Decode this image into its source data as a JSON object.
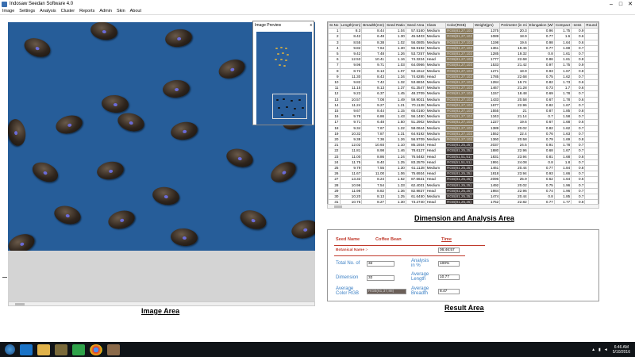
{
  "window": {
    "title": "Indosaw Seedan Software 4.0",
    "controls": [
      "–",
      "□",
      "✕"
    ]
  },
  "menu": [
    "Image",
    "Settings",
    "Analysis",
    "Cluster",
    "Reports",
    "Admin",
    "Skin",
    "About"
  ],
  "preview": {
    "title": "Image Preview",
    "close": "x"
  },
  "captions": {
    "image_area": "Image Area",
    "dimension_area": "Dimension and Analysis Area",
    "result_area": "Result  Area"
  },
  "table": {
    "headers": [
      "Sr.No",
      "Length(mm)",
      "Breadth(mm)",
      "Seed Ratio",
      "Seed Area",
      "Class",
      "Color(RGB)",
      "Weight(gm)",
      "Perimeter (in mi",
      "Elongation (W/",
      "Compact",
      "-ness",
      "Round"
    ],
    "rows": [
      [
        "1",
        "8.3",
        "8.44",
        "1.04",
        "57.5160",
        "Medium",
        "RGB(81,27,101",
        "1375",
        "20.3",
        "0.96",
        "1.75",
        "0.9"
      ],
      [
        "2",
        "8.42",
        "6.48",
        "1.30",
        "45.5403",
        "Medium",
        "RGB(81,27,102",
        "1089",
        "18.9",
        "0.77",
        "1.6",
        "0.6"
      ],
      [
        "3",
        "8.55",
        "8.38",
        "1.02",
        "56.0805",
        "Medium",
        "RGB(81,27,102",
        "1198",
        "19.6",
        "0.98",
        "1.64",
        "0.6"
      ],
      [
        "4",
        "9.82",
        "7.64",
        "1.30",
        "56.9192",
        "Medium",
        "RGB(81,27,102",
        "1361",
        "19.46",
        "0.77",
        "1.69",
        "0.7"
      ],
      [
        "5",
        "9.42",
        "7.48",
        "1.26",
        "53.7257",
        "Medium",
        "RGB(81,27,102",
        "1285",
        "19.32",
        "0.8",
        "1.61",
        "0.7"
      ],
      [
        "6",
        "12.53",
        "10.41",
        "1.16",
        "74.3224",
        "Head",
        "RGB(81,27,102",
        "1777",
        "22.68",
        "0.86",
        "1.61",
        "0.8"
      ],
      [
        "7",
        "9.96",
        "9.71",
        "1.03",
        "64.0966",
        "Medium",
        "RGB(81,27,102",
        "1533",
        "21.42",
        "0.97",
        "1.75",
        "0.9"
      ],
      [
        "8",
        "8.72",
        "8.13",
        "1.07",
        "53.1612",
        "Medium",
        "RGB(81,27,102",
        "1271",
        "18.9",
        "0.93",
        "1.67",
        "0.8"
      ],
      [
        "9",
        "11.30",
        "8.43",
        "1.34",
        "74.6285",
        "Head",
        "RGB(81,27,102",
        "1785",
        "22.68",
        "0.75",
        "1.62",
        "0.7"
      ],
      [
        "10",
        "9.82",
        "7.42",
        "1.32",
        "53.6834",
        "Medium",
        "RGB(81,27,102",
        "1284",
        "19.74",
        "0.82",
        "1.73",
        "0.6"
      ],
      [
        "11",
        "11.15",
        "8.13",
        "1.37",
        "61.3547",
        "Medium",
        "RGB(81,27,102",
        "1467",
        "21.28",
        "0.73",
        "1.7",
        "0.6"
      ],
      [
        "12",
        "9.22",
        "6.37",
        "1.45",
        "48.3709",
        "Medium",
        "RGB(81,27,102",
        "1157",
        "18.48",
        "0.69",
        "1.78",
        "0.7"
      ],
      [
        "13",
        "10.57",
        "7.08",
        "1.49",
        "59.9031",
        "Medium",
        "RGB(81,27,102",
        "1433",
        "20.58",
        "0.67",
        "1.78",
        "0.6"
      ],
      [
        "14",
        "11.24",
        "9.27",
        "1.21",
        "70.1128",
        "Medium",
        "RGB(81,27,102",
        "1677",
        "22.96",
        "0.82",
        "1.67",
        "0.7"
      ],
      [
        "15",
        "9.67",
        "8.44",
        "1.15",
        "65.0160",
        "Medium",
        "RGB(81,27,102",
        "1555",
        "21",
        "0.87",
        "1.85",
        "0.8"
      ],
      [
        "16",
        "9.78",
        "6.86",
        "1.43",
        "56.1450",
        "Medium",
        "RGB(81,27,102",
        "1343",
        "21.14",
        "0.7",
        "1.58",
        "0.7"
      ],
      [
        "17",
        "9.71",
        "6.48",
        "1.50",
        "51.2902",
        "Medium",
        "RGB(81,27,102",
        "1227",
        "19.6",
        "0.67",
        "1.68",
        "0.6"
      ],
      [
        "18",
        "9.34",
        "7.67",
        "1.22",
        "58.0644",
        "Medium",
        "RGB(81,27,102",
        "1389",
        "20.02",
        "0.82",
        "1.62",
        "0.7"
      ],
      [
        "19",
        "10.32",
        "7.87",
        "1.31",
        "64.9192",
        "Medium",
        "RGB(81,27,102",
        "1552",
        "22.4",
        "0.76",
        "1.63",
        "0.7"
      ],
      [
        "20",
        "9.38",
        "7.36",
        "1.26",
        "56.9709",
        "Medium",
        "RGB(81,27,102",
        "1360",
        "20.58",
        "0.79",
        "1.69",
        "0.8"
      ],
      [
        "21",
        "12.02",
        "10.93",
        "1.10",
        "85.1934",
        "Head",
        "RGB(81,25,25)",
        "2037",
        "24.5",
        "0.91",
        "1.78",
        "0.7"
      ],
      [
        "22",
        "11.81",
        "8.98",
        "1.46",
        "78.6127",
        "Head",
        "RGB(81,25,25)",
        "1880",
        "22.96",
        "0.68",
        "1.67",
        "0.7"
      ],
      [
        "23",
        "11.00",
        "8.86",
        "1.24",
        "76.5482",
        "Head",
        "RGB(51,51,51)",
        "1831",
        "23.94",
        "0.81",
        "1.68",
        "0.8"
      ],
      [
        "24",
        "11.75",
        "9.40",
        "1.25",
        "83.2579",
        "Head",
        "RGB(51,51,51)",
        "1991",
        "24.08",
        "0.8",
        "1.8",
        "0.7"
      ],
      [
        "25",
        "9.79",
        "7.55",
        "1.30",
        "61.1128",
        "Medium",
        "RGB(81,25,25)",
        "1461",
        "20.44",
        "0.77",
        "1.84",
        "0.8"
      ],
      [
        "26",
        "11.67",
        "11.00",
        "1.06",
        "75.6934",
        "Head",
        "RGB(81,25,25)",
        "1818",
        "23.94",
        "0.93",
        "1.66",
        "0.7"
      ],
      [
        "27",
        "13.33",
        "8.24",
        "1.62",
        "87.6631",
        "Head",
        "RGB(81,25,25)",
        "2096",
        "25.9",
        "0.62",
        "1.64",
        "0.6"
      ],
      [
        "28",
        "10.96",
        "7.54",
        "1.33",
        "62.4031",
        "Medium",
        "RGB(81,25,25)",
        "1492",
        "20.02",
        "0.75",
        "1.96",
        "0.7"
      ],
      [
        "29",
        "11.98",
        "8.82",
        "1.36",
        "82.9837",
        "Head",
        "RGB(81,25,25)",
        "1984",
        "22.96",
        "0.74",
        "1.96",
        "0.7"
      ],
      [
        "30",
        "10.20",
        "8.13",
        "1.25",
        "61.6450",
        "Medium",
        "RGB(81,25,25)",
        "1474",
        "20.44",
        "0.8",
        "1.85",
        "0.7"
      ],
      [
        "31",
        "10.75",
        "8.27",
        "1.30",
        "73.2740",
        "Head",
        "RGB(81,25,25)",
        "1752",
        "22.82",
        "0.77",
        "1.77",
        "0.8"
      ],
      [
        "32",
        "12.07",
        "8.45",
        "1.44",
        "86.6934",
        "Head",
        "RGB(81,25,25)",
        "2073",
        "24.64",
        "0.7",
        "1.79",
        "0.7"
      ]
    ]
  },
  "result": {
    "seed_name_label": "Seed Name",
    "seed_name_value": "Coffee Bean",
    "time_label": "Time",
    "botanical_label": "Botanical Name :-",
    "time_value": "06:46:57",
    "total_label": "Total No. of",
    "total_value": "32",
    "analysis_label": "Analysis in %",
    "analysis_value": "100%",
    "dimension_label": "Dimension",
    "dimension_value": "32",
    "avg_length_label": "Average Length",
    "avg_length_value": "10.77",
    "avg_color_label": "Average Color RGB",
    "avg_color_value": "RGB(61,37,88)",
    "avg_breadth_label": "Average Breadth",
    "avg_breadth_value": "8.47"
  },
  "taskbar": {
    "time": "6:46 AM",
    "date": "5/10/2016"
  },
  "colors": {
    "image_bg": "#265d99",
    "accent_red": "#c0392b",
    "label_blue": "#3a7fc4"
  }
}
